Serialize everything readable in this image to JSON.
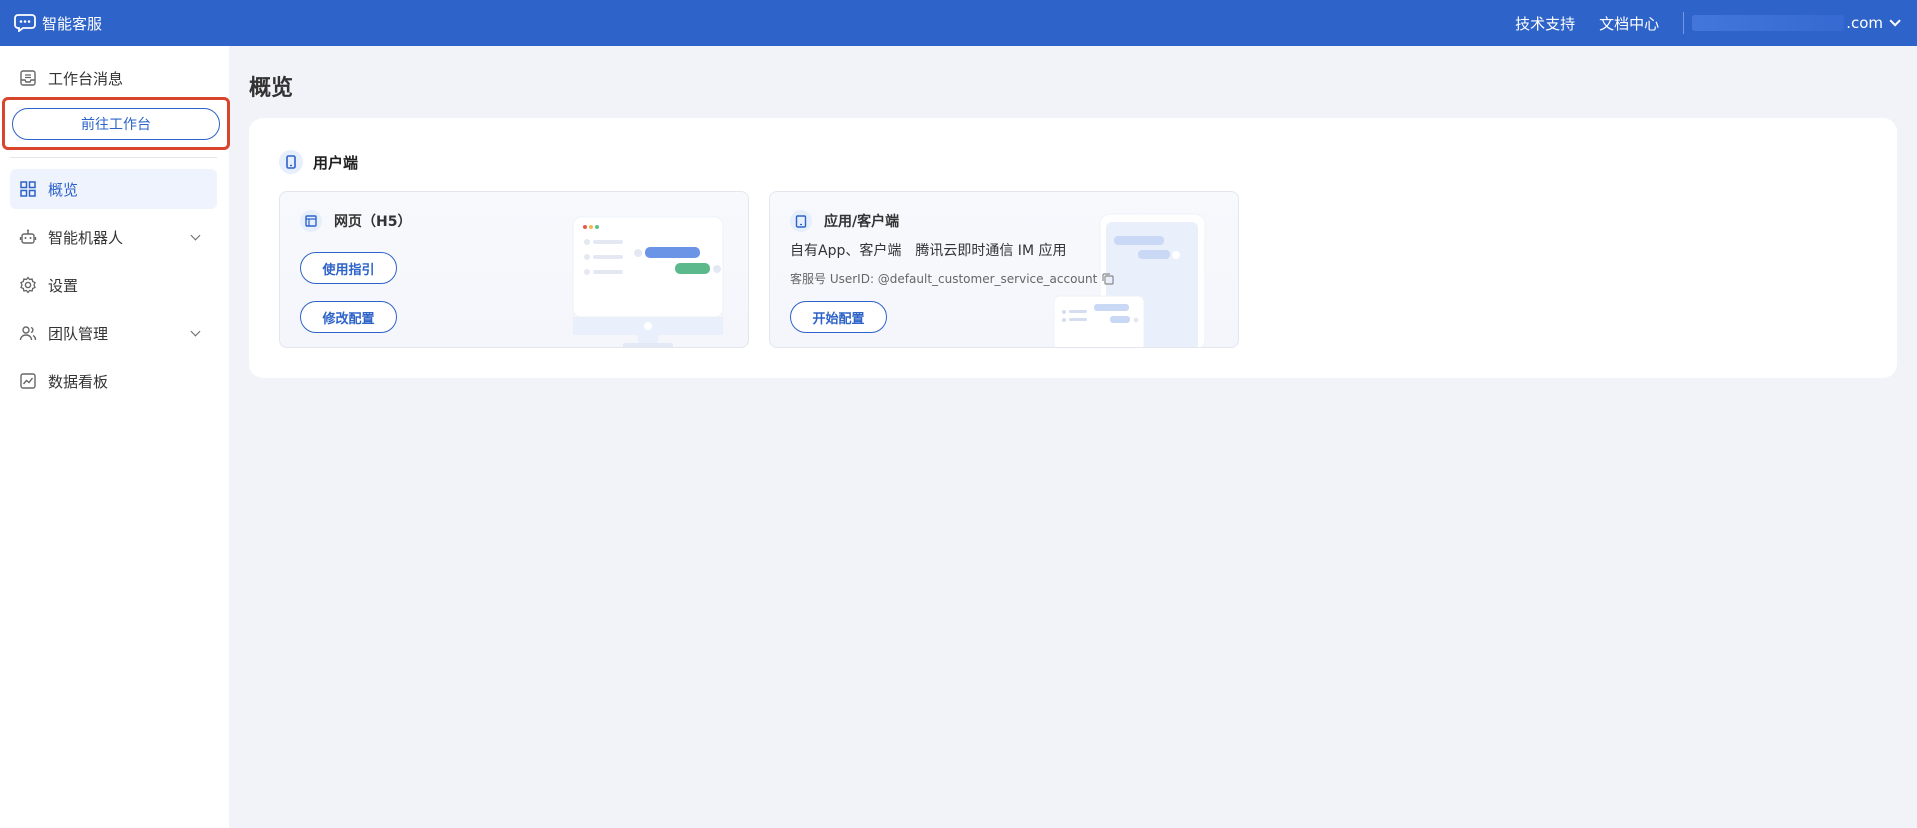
{
  "header": {
    "app_title": "智能客服",
    "links": [
      "技术支持",
      "文档中心"
    ],
    "account_suffix": ".com"
  },
  "sidebar": {
    "workbench_msg_label": "工作台消息",
    "goto_workbench_label": "前往工作台",
    "items": [
      {
        "label": "概览",
        "active": true
      },
      {
        "label": "智能机器人",
        "expandable": true
      },
      {
        "label": "设置"
      },
      {
        "label": "团队管理",
        "expandable": true
      },
      {
        "label": "数据看板"
      }
    ]
  },
  "main": {
    "title": "概览",
    "section_title": "用户端",
    "web_card": {
      "title": "网页（H5）",
      "buttons": [
        "使用指引",
        "修改配置"
      ]
    },
    "app_card": {
      "title": "应用/客户端",
      "desc_1": "自有App、客户端",
      "desc_2": "腾讯云即时通信 IM 应用",
      "userid_text": "客服号 UserID: @default_customer_service_account",
      "button": "开始配置"
    }
  },
  "colors": {
    "topbar": "#2e63c9",
    "accent": "#2e63c9",
    "highlight_border": "#d9442d",
    "background": "#f2f3f8"
  },
  "icons": [
    "chat-bubble-icon",
    "inbox-icon",
    "grid-icon",
    "robot-icon",
    "gear-icon",
    "team-icon",
    "chart-icon",
    "phone-icon",
    "browser-icon",
    "tablet-icon",
    "copy-icon",
    "chevron-down-icon"
  ]
}
